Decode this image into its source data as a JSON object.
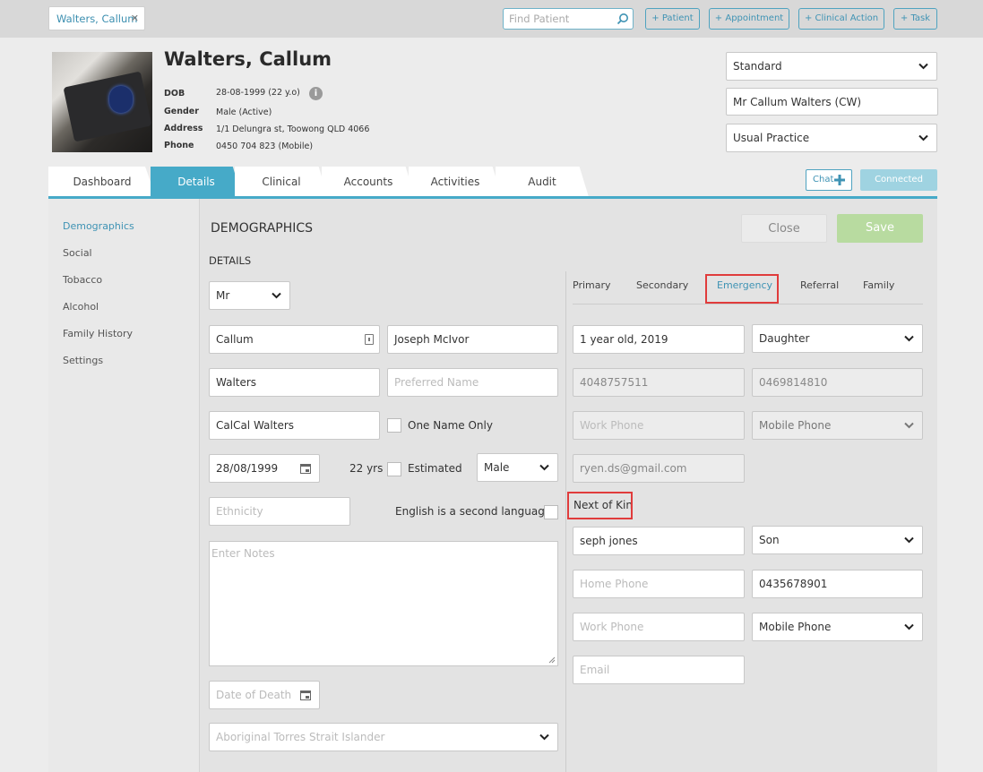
{
  "topbar": {
    "patient_tab": "Walters, Callum",
    "close_glyph": "✕",
    "search_placeholder": "Find Patient",
    "buttons": [
      "+ Patient",
      "+ Appointment",
      "+ Clinical Action",
      "+ Task"
    ]
  },
  "patient": {
    "name": "Walters, Callum",
    "labels": {
      "dob": "DOB",
      "gender": "Gender",
      "address": "Address",
      "phone": "Phone"
    },
    "dob": "28-08-1999 (22 y.o)",
    "gender": "Male (Active)",
    "address": "1/1 Delungra st, Toowong QLD 4066",
    "phone": "0450 704 823 (Mobile)"
  },
  "right_header": {
    "billing_type": "Standard",
    "display_name": "Mr Callum Walters (CW)",
    "practice": "Usual Practice"
  },
  "tabs": [
    "Dashboard",
    "Details",
    "Clinical",
    "Accounts",
    "Activities",
    "Audit"
  ],
  "active_tab": "Details",
  "chat_label": "Chat",
  "connected_label": "Connected",
  "sidebar": [
    "Demographics",
    "Social",
    "Tobacco",
    "Alcohol",
    "Family History",
    "Settings"
  ],
  "demographics": {
    "heading": "DEMOGRAPHICS",
    "close_label": "Close",
    "save_label": "Save",
    "details_heading": "DETAILS",
    "title": "Mr",
    "first_name": "Callum",
    "middle_name": "Joseph McIvor",
    "last_name": "Walters",
    "preferred_placeholder": "Preferred Name",
    "alias": "CalCal Walters",
    "one_name_only": "One Name Only",
    "birth_date": "28/08/1999",
    "age": "22 yrs",
    "estimated": "Estimated",
    "sex": "Male",
    "ethnicity_placeholder": "Ethnicity",
    "second_language": "English is a second language",
    "notes_placeholder": "Enter Notes",
    "death_placeholder": "Date of Death",
    "aboriginal_placeholder": "Aboriginal Torres Strait Islander"
  },
  "contacts": {
    "subtabs": [
      "Primary",
      "Secondary",
      "Emergency",
      "Referral",
      "Family"
    ],
    "active_subtab": "Emergency",
    "emergency": {
      "name": "1 year old, 2019",
      "relationship": "Daughter",
      "home_phone": "4048757511",
      "mobile": "0469814810",
      "work_placeholder": "Work Phone",
      "phone_type": "Mobile Phone",
      "email": "ryen.ds@gmail.com"
    },
    "next_of_kin_heading": "Next of Kin",
    "next_of_kin": {
      "name": "seph jones",
      "relationship": "Son",
      "home_placeholder": "Home Phone",
      "mobile": "0435678901",
      "work_placeholder": "Work Phone",
      "phone_type": "Mobile Phone",
      "email_placeholder": "Email"
    }
  },
  "colors": {
    "accent": "#46aac8",
    "save": "#b8dba0",
    "highlight": "#e03c3c"
  }
}
